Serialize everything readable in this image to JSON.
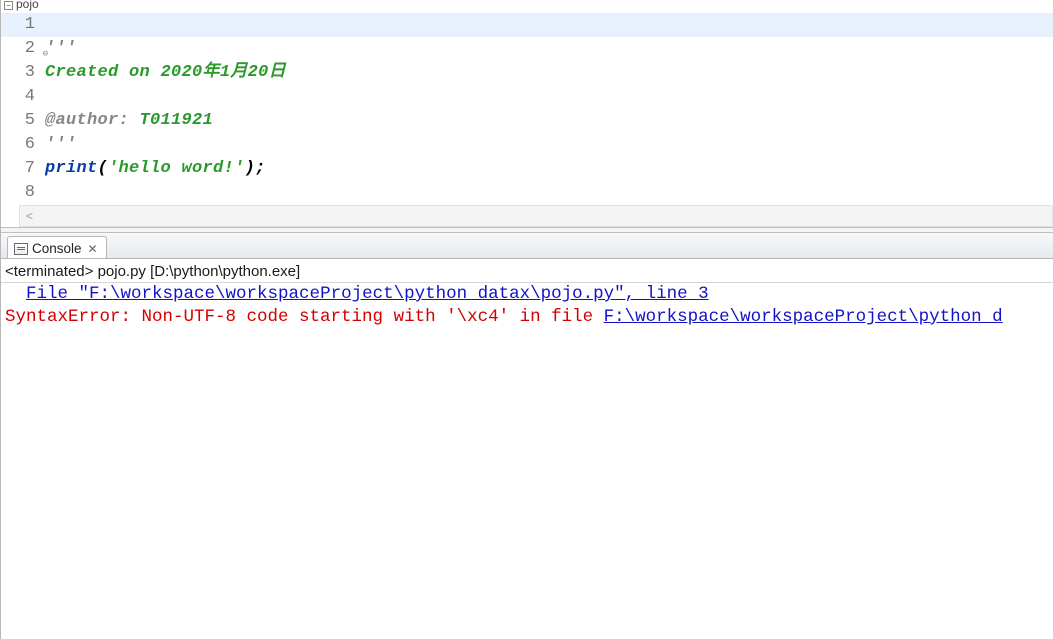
{
  "editor": {
    "expand_label": "pojo",
    "lines": [
      {
        "n": "1",
        "fold": "",
        "segments": []
      },
      {
        "n": "2",
        "fold": "⊖",
        "segments": [
          {
            "cls": "tok-docq",
            "t": "'''"
          }
        ]
      },
      {
        "n": "3",
        "fold": "",
        "segments": [
          {
            "cls": "tok-str",
            "t": "Created on 2020年1月20日"
          }
        ]
      },
      {
        "n": "4",
        "fold": "",
        "segments": []
      },
      {
        "n": "5",
        "fold": "",
        "segments": [
          {
            "cls": "tok-tag",
            "t": "@author:"
          },
          {
            "cls": "",
            "t": " "
          },
          {
            "cls": "tok-str",
            "t": "T011921"
          }
        ]
      },
      {
        "n": "6",
        "fold": "",
        "segments": [
          {
            "cls": "tok-docq",
            "t": "'''"
          }
        ]
      },
      {
        "n": "7",
        "fold": "",
        "segments": [
          {
            "cls": "tok-func",
            "t": "print"
          },
          {
            "cls": "tok-punct",
            "t": "("
          },
          {
            "cls": "tok-str",
            "t": "'hello word!'"
          },
          {
            "cls": "tok-punct",
            "t": ");"
          }
        ]
      },
      {
        "n": "8",
        "fold": "",
        "segments": []
      }
    ],
    "scroll_hint": "<"
  },
  "console": {
    "tab_label": "Console",
    "terminated_prefix": "<terminated> ",
    "run_target": "pojo.py [D:\\python\\python.exe]",
    "line1_indent": "  ",
    "line1_link": "File \"F:\\workspace\\workspaceProject\\python_datax\\pojo.py\", line 3",
    "line2_err": "SyntaxError: Non-UTF-8 code starting with '\\xc4' in file ",
    "line2_link": "F:\\workspace\\workspaceProject\\python_d"
  }
}
